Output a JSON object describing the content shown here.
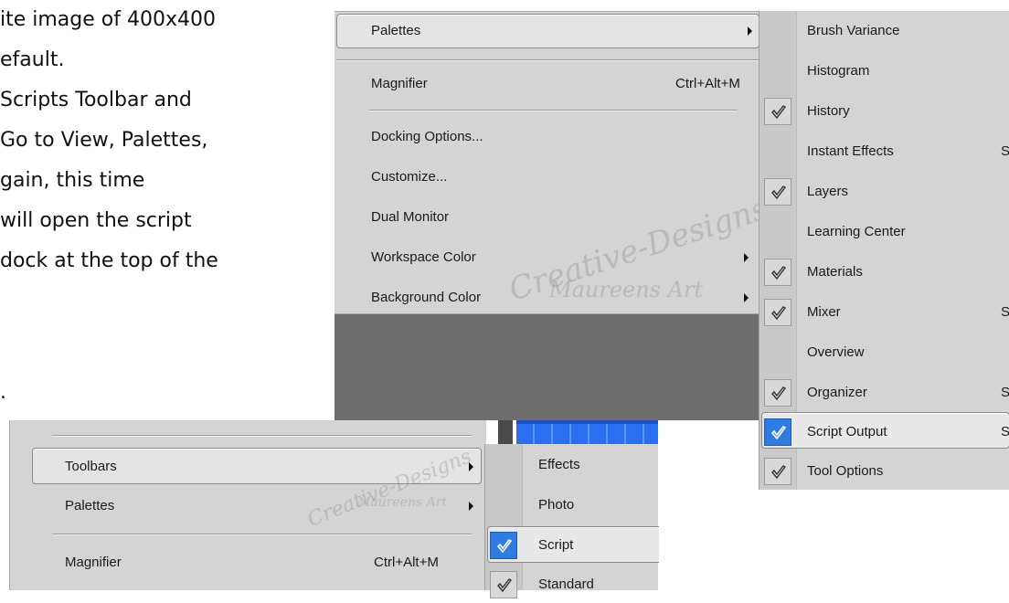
{
  "tutorial_lines": [
    "ite image of 400x400",
    "efault.",
    "Scripts Toolbar and",
    "Go to View, Palettes,",
    "gain, this time",
    "will open the script",
    "dock at the top of the",
    "."
  ],
  "view_menu_top": {
    "palettes": "Palettes",
    "magnifier": "Magnifier",
    "magnifier_shortcut": "Ctrl+Alt+M",
    "docking": "Docking Options...",
    "customize": "Customize...",
    "dual_monitor": "Dual Monitor",
    "workspace_color": "Workspace Color",
    "background_color": "Background Color"
  },
  "palettes_submenu": {
    "items": [
      {
        "label": "Brush Variance",
        "checked": false,
        "shortcut": ""
      },
      {
        "label": "Histogram",
        "checked": false,
        "shortcut": ""
      },
      {
        "label": "History",
        "checked": true,
        "shortcut": ""
      },
      {
        "label": "Instant Effects",
        "checked": false,
        "shortcut": "S"
      },
      {
        "label": "Layers",
        "checked": true,
        "shortcut": ""
      },
      {
        "label": "Learning Center",
        "checked": false,
        "shortcut": ""
      },
      {
        "label": "Materials",
        "checked": true,
        "shortcut": ""
      },
      {
        "label": "Mixer",
        "checked": true,
        "shortcut": "S"
      },
      {
        "label": "Overview",
        "checked": false,
        "shortcut": ""
      },
      {
        "label": "Organizer",
        "checked": true,
        "shortcut": "S"
      },
      {
        "label": "Script Output",
        "checked": true,
        "shortcut": "S",
        "highlighted": true
      },
      {
        "label": "Tool Options",
        "checked": true,
        "shortcut": ""
      }
    ]
  },
  "view_menu_bottom": {
    "toolbars": "Toolbars",
    "palettes": "Palettes",
    "magnifier": "Magnifier",
    "magnifier_shortcut": "Ctrl+Alt+M"
  },
  "toolbars_submenu": {
    "items": [
      {
        "label": "Effects",
        "checked": false
      },
      {
        "label": "Photo",
        "checked": false
      },
      {
        "label": "Script",
        "checked": true,
        "highlighted": true
      },
      {
        "label": "Standard",
        "checked": true
      }
    ]
  },
  "watermark": {
    "line1": "Creative-Designs",
    "line2": "Maureens Art"
  },
  "colors": {
    "menu_bg": "#d4d4d4",
    "workspace_gray": "#6e6e6e",
    "check_active": "#2f7be0",
    "toolbar_blue": "#2a6ff0"
  }
}
